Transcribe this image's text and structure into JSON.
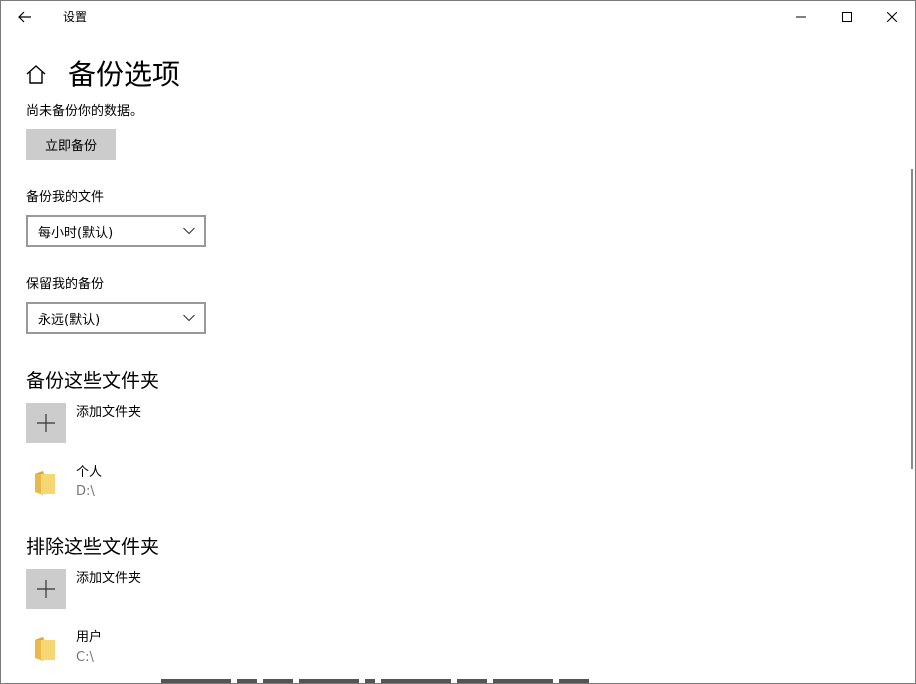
{
  "titlebar": {
    "back_icon": "arrow-left-icon",
    "title": "设置",
    "minimize_icon": "minimize-icon",
    "maximize_icon": "maximize-icon",
    "close_icon": "close-icon"
  },
  "header": {
    "home_icon": "home-icon",
    "title": "备份选项"
  },
  "status": {
    "text": "尚未备份你的数据。",
    "backup_now_label": "立即备份"
  },
  "backup_frequency": {
    "label": "备份我的文件",
    "selected": "每小时(默认)"
  },
  "keep_backups": {
    "label": "保留我的备份",
    "selected": "永远(默认)"
  },
  "include_section": {
    "title": "备份这些文件夹",
    "add_label": "添加文件夹",
    "folders": [
      {
        "name": "个人",
        "path": "D:\\"
      }
    ]
  },
  "exclude_section": {
    "title": "排除这些文件夹",
    "add_label": "添加文件夹",
    "folders": [
      {
        "name": "用户",
        "path": "C:\\"
      }
    ]
  },
  "colors": {
    "button_bg": "#cccccc",
    "dropdown_border": "#999999",
    "folder_yellow": "#f7d774",
    "secondary_text": "#767676"
  }
}
